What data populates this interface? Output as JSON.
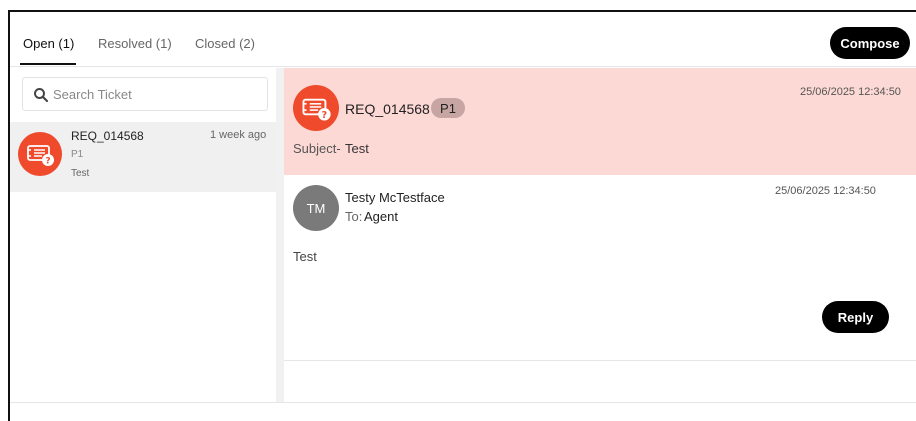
{
  "tabs": [
    {
      "label": "Open (1)",
      "active": true
    },
    {
      "label": "Resolved (1)",
      "active": false
    },
    {
      "label": "Closed (2)",
      "active": false
    }
  ],
  "compose_label": "Compose",
  "search": {
    "placeholder": "Search Ticket",
    "value": ""
  },
  "ticket_list": [
    {
      "id": "REQ_014568",
      "time": "1 week ago",
      "priority": "P1",
      "subject": "Test",
      "icon": "ticket-help-icon"
    }
  ],
  "detail": {
    "id": "REQ_014568",
    "priority": "P1",
    "timestamp": "25/06/2025 12:34:50",
    "subject_label": "Subject-",
    "subject": "Test",
    "icon": "ticket-help-icon"
  },
  "message": {
    "initials": "TM",
    "sender": "Testy McTestface",
    "to_label": "To:",
    "to": "Agent",
    "timestamp": "25/06/2025 12:34:50",
    "body": "Test"
  },
  "reply_label": "Reply",
  "colors": {
    "accent": "#f04a2c",
    "header_bg": "#fdd9d5",
    "badge_bg": "#c6a5a3",
    "avatar_bg": "#7a7a7a",
    "button_bg": "#000000"
  }
}
